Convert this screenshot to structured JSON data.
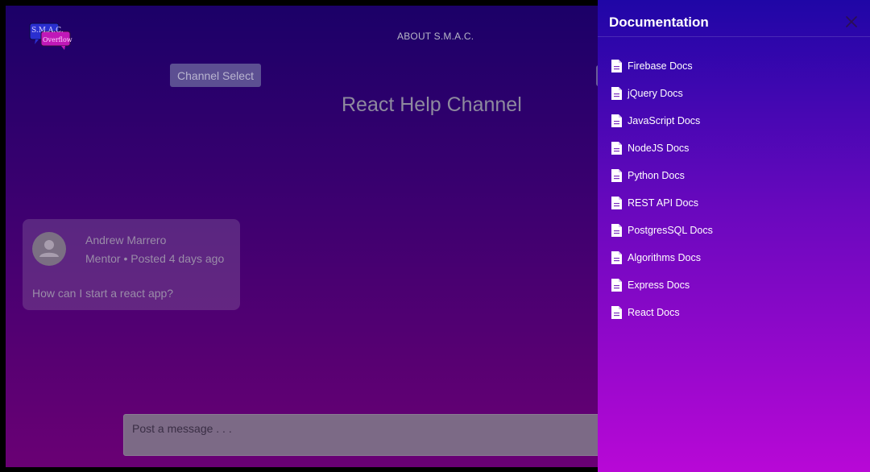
{
  "header": {
    "logo_text_line1": "S.M.A.C.",
    "logo_text_line2": "Overflow",
    "about_link": "ABOUT S.M.A.C."
  },
  "controls": {
    "channel_select_label": "Channel Select"
  },
  "channel": {
    "title": "React Help Channel"
  },
  "posts": [
    {
      "author": "Andrew Marrero",
      "role": "Mentor",
      "separator": "•",
      "posted": "Posted 4 days ago",
      "body": "How can I start a react app?"
    }
  ],
  "composer": {
    "placeholder": "Post a message . . ."
  },
  "drawer": {
    "title": "Documentation",
    "items": [
      {
        "label": "Firebase Docs",
        "icon": "document-icon"
      },
      {
        "label": "jQuery Docs",
        "icon": "document-icon"
      },
      {
        "label": "JavaScript Docs",
        "icon": "document-icon"
      },
      {
        "label": "NodeJS Docs",
        "icon": "document-icon"
      },
      {
        "label": "Python Docs",
        "icon": "document-icon"
      },
      {
        "label": "REST API Docs",
        "icon": "document-icon"
      },
      {
        "label": "PostgresSQL Docs",
        "icon": "document-icon"
      },
      {
        "label": "Algorithms Docs",
        "icon": "document-icon"
      },
      {
        "label": "Express Docs",
        "icon": "document-icon"
      },
      {
        "label": "React Docs",
        "icon": "document-icon"
      }
    ]
  },
  "colors": {
    "drawer_top": "#1f06a6",
    "drawer_bottom": "#b808d6",
    "app_top": "#1b0068",
    "app_bottom": "#6a0074"
  }
}
